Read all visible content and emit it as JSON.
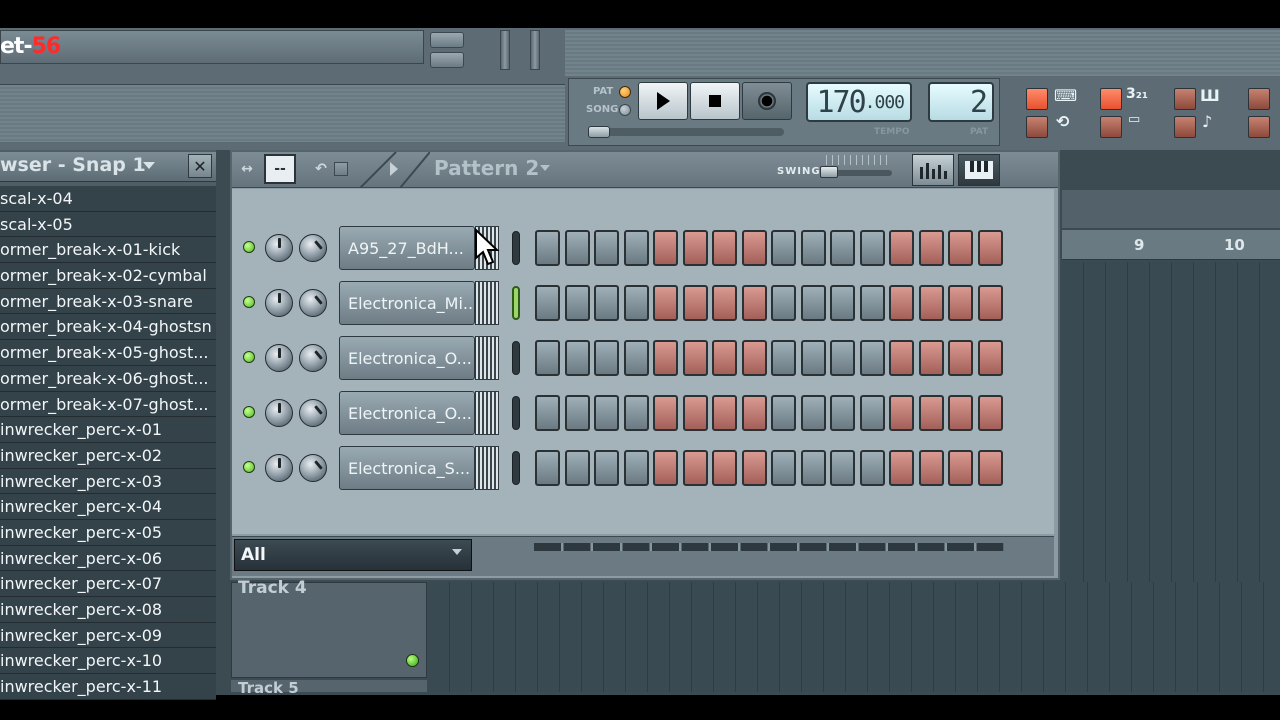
{
  "app": {
    "title_prefix": "et-",
    "title_suffix": "56"
  },
  "transport": {
    "pat_label": "PAT",
    "song_label": "SONG",
    "mode": "pattern",
    "play_icon": "play-icon",
    "stop_icon": "stop-icon",
    "record_icon": "record-icon",
    "tempo": "170",
    "tempo_fraction": ".000",
    "tempo_label": "TEMPO",
    "pattern_number": "2",
    "pattern_label": "PAT"
  },
  "browser": {
    "title": "wser - Snap 1",
    "items": [
      "scal-x-04",
      "scal-x-05",
      "ormer_break-x-01-kick",
      "ormer_break-x-02-cymbal",
      "ormer_break-x-03-snare",
      "ormer_break-x-04-ghostsn",
      "ormer_break-x-05-ghost...",
      "ormer_break-x-06-ghost...",
      "ormer_break-x-07-ghost...",
      "inwrecker_perc-x-01",
      "inwrecker_perc-x-02",
      "inwrecker_perc-x-03",
      "inwrecker_perc-x-04",
      "inwrecker_perc-x-05",
      "inwrecker_perc-x-06",
      "inwrecker_perc-x-07",
      "inwrecker_perc-x-08",
      "inwrecker_perc-x-09",
      "inwrecker_perc-x-10",
      "inwrecker_perc-x-11"
    ]
  },
  "sequencer": {
    "pattern_name": "Pattern 2",
    "swing_label": "SWING",
    "filter": "All",
    "channels": [
      {
        "name": "A95_27_BdH...",
        "selected": false,
        "steps": [
          0,
          0,
          0,
          0,
          1,
          1,
          1,
          1,
          0,
          0,
          0,
          0,
          1,
          1,
          1,
          1
        ]
      },
      {
        "name": "Electronica_Mi...",
        "selected": true,
        "steps": [
          0,
          0,
          0,
          0,
          1,
          1,
          1,
          1,
          0,
          0,
          0,
          0,
          1,
          1,
          1,
          1
        ]
      },
      {
        "name": "Electronica_O...",
        "selected": false,
        "steps": [
          0,
          0,
          0,
          0,
          1,
          1,
          1,
          1,
          0,
          0,
          0,
          0,
          1,
          1,
          1,
          1
        ]
      },
      {
        "name": "Electronica_O...",
        "selected": false,
        "steps": [
          0,
          0,
          0,
          0,
          1,
          1,
          1,
          1,
          0,
          0,
          0,
          0,
          1,
          1,
          1,
          1
        ]
      },
      {
        "name": "Electronica_S...",
        "selected": false,
        "steps": [
          0,
          0,
          0,
          0,
          1,
          1,
          1,
          1,
          0,
          0,
          0,
          0,
          1,
          1,
          1,
          1
        ]
      }
    ]
  },
  "playlist": {
    "bar_numbers": [
      "9",
      "10"
    ],
    "tracks": [
      "Track 4",
      "Track 5"
    ]
  },
  "colors": {
    "step_active": "#c07a72",
    "step_inactive": "#8495a0",
    "led_green": "#4cbb22",
    "title_red": "#ff2a2a"
  }
}
